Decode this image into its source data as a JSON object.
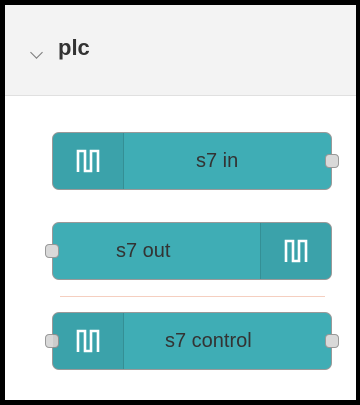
{
  "palette": {
    "category": {
      "name": "plc",
      "expanded": true,
      "chevron_icon": "chevron-down-icon"
    },
    "nodes": [
      {
        "label": "s7 in",
        "icon": "square-wave-icon",
        "color": "#3fadb5",
        "ports": [
          "output"
        ]
      },
      {
        "label": "s7 out",
        "icon": "square-wave-icon",
        "color": "#3fadb5",
        "ports": [
          "input"
        ]
      },
      {
        "label": "s7 control",
        "icon": "square-wave-icon",
        "color": "#3fadb5",
        "ports": [
          "input",
          "output"
        ]
      }
    ],
    "port_color": "#d9d9d9",
    "header_background": "#f3f3f3"
  }
}
